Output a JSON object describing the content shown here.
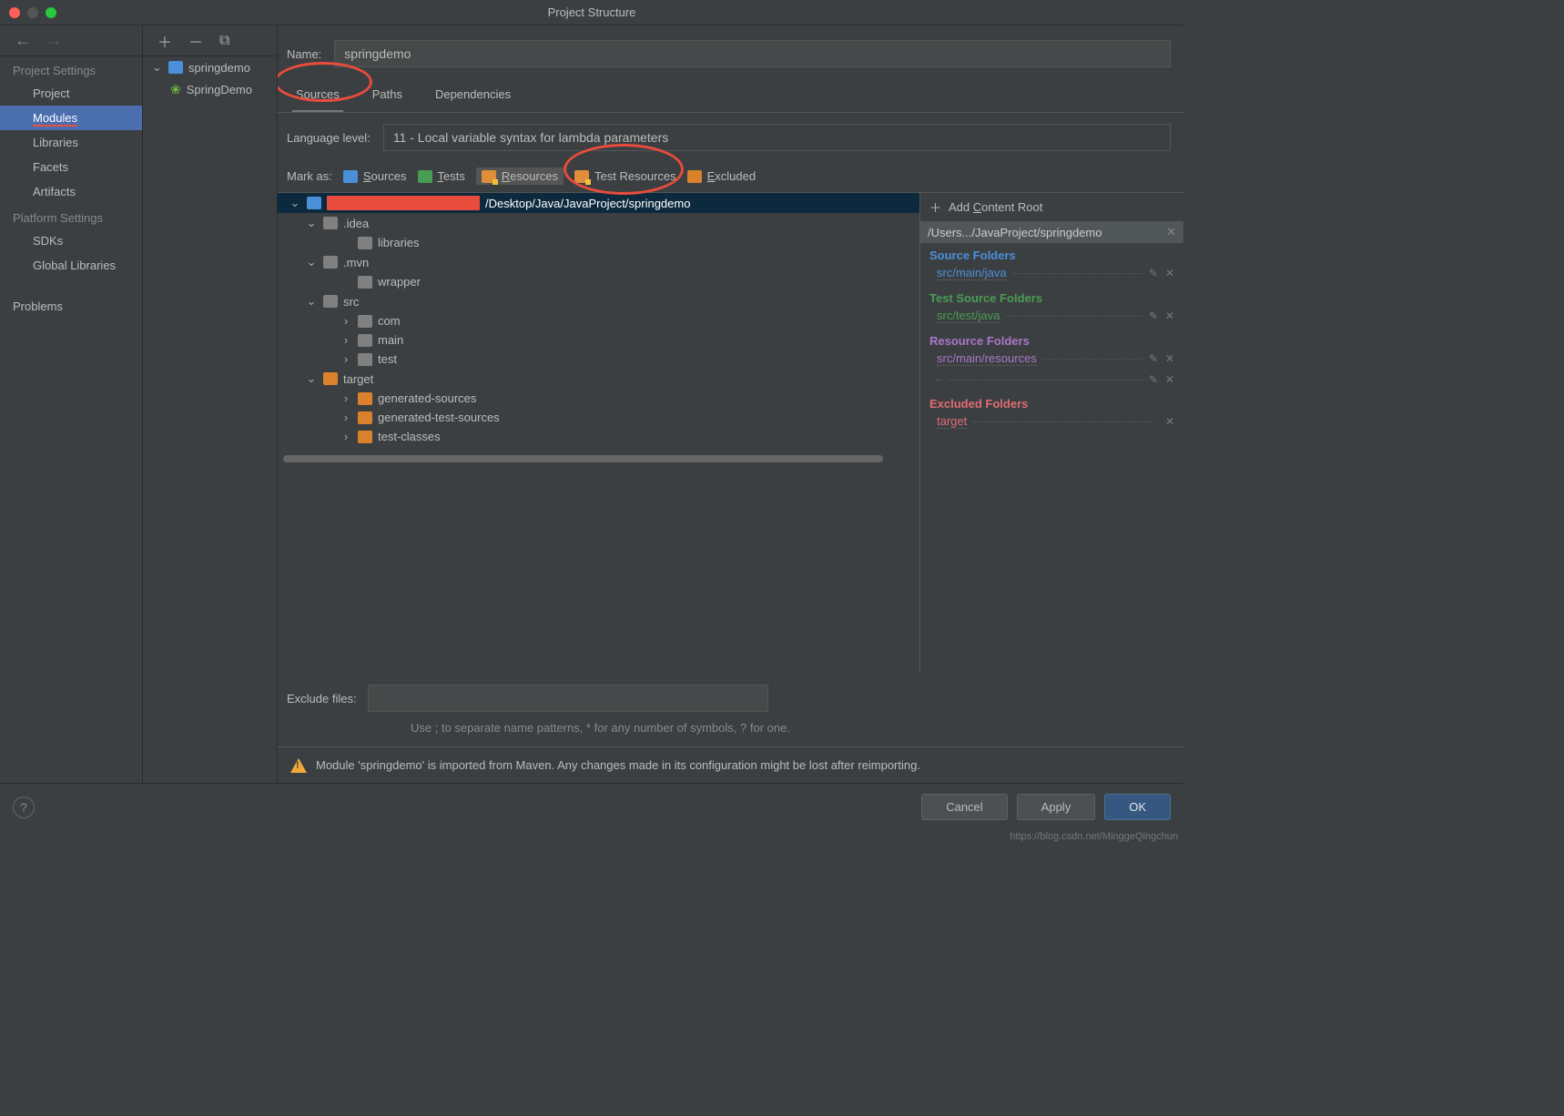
{
  "window": {
    "title": "Project Structure"
  },
  "leftnav": {
    "sections": {
      "project_settings": "Project Settings",
      "platform_settings": "Platform Settings"
    },
    "items": {
      "project": "Project",
      "modules": "Modules",
      "libraries": "Libraries",
      "facets": "Facets",
      "artifacts": "Artifacts",
      "sdks": "SDKs",
      "global_libraries": "Global Libraries",
      "problems": "Problems"
    }
  },
  "module_tree": {
    "root": "springdemo",
    "child": "SpringDemo"
  },
  "name": {
    "label": "Name:",
    "value": "springdemo"
  },
  "tabs": {
    "sources": "Sources",
    "paths": "Paths",
    "dependencies": "Dependencies"
  },
  "language_level": {
    "label": "Language level:",
    "value": "11 - Local variable syntax for lambda parameters"
  },
  "mark_as": {
    "label": "Mark as:",
    "sources": "Sources",
    "tests": "Tests",
    "resources": "Resources",
    "test_resources": "Test Resources",
    "excluded": "Excluded"
  },
  "dir_tree": {
    "root_suffix": "/Desktop/Java/JavaProject/springdemo",
    "idea": ".idea",
    "libraries": "libraries",
    "mvn": ".mvn",
    "wrapper": "wrapper",
    "src": "src",
    "com": "com",
    "main": "main",
    "test": "test",
    "target": "target",
    "generated_sources": "generated-sources",
    "generated_test_sources": "generated-test-sources",
    "test_classes": "test-classes"
  },
  "content_root": {
    "add_label": "Add Content Root",
    "root_path": "/Users.../JavaProject/springdemo",
    "source_folders": "Source Folders",
    "source_path": "src/main/java",
    "test_source_folders": "Test Source Folders",
    "test_source_path": "src/test/java",
    "resource_folders": "Resource Folders",
    "resource_path": "src/main/resources",
    "excluded_folders": "Excluded Folders",
    "excluded_path": "target"
  },
  "exclude": {
    "label": "Exclude files:",
    "hint": "Use ; to separate name patterns, * for any number of symbols, ? for one."
  },
  "maven_warning": "Module 'springdemo' is imported from Maven. Any changes made in its configuration might be lost after reimporting.",
  "buttons": {
    "cancel": "Cancel",
    "apply": "Apply",
    "ok": "OK"
  },
  "watermark": "https://blog.csdn.net/MinggeQingchun"
}
